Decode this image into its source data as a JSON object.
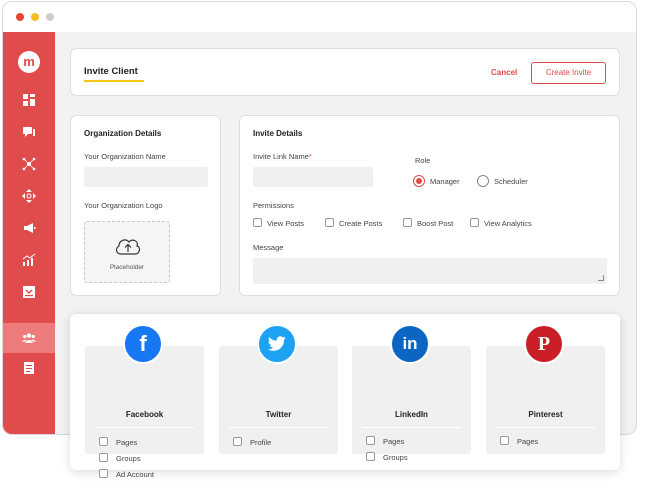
{
  "window": {
    "colors": {
      "accent": "#e04b4b",
      "underline": "#f5c518"
    }
  },
  "sidebar": {
    "logo": "m",
    "items": [
      {
        "icon": "dashboard-icon"
      },
      {
        "icon": "chat-icon"
      },
      {
        "icon": "network-icon"
      },
      {
        "icon": "move-icon"
      },
      {
        "icon": "megaphone-icon"
      },
      {
        "icon": "analytics-icon"
      },
      {
        "icon": "inbox-icon"
      },
      {
        "icon": "users-icon",
        "active": true
      },
      {
        "icon": "document-icon"
      }
    ]
  },
  "header": {
    "title": "Invite Client",
    "cancel_label": "Cancel",
    "create_label": "Create Invite"
  },
  "organization": {
    "title": "Organization Details",
    "name_label": "Your Organization Name",
    "name_value": "",
    "logo_label": "Your Organization Logo",
    "logo_placeholder": "Placeholder"
  },
  "invite": {
    "title": "Invite Details",
    "link_label": "Invite Link Name",
    "required_mark": "*",
    "link_value": "",
    "role_label": "Role",
    "roles": [
      {
        "label": "Manager",
        "selected": true
      },
      {
        "label": "Scheduler",
        "selected": false
      }
    ],
    "permissions_label": "Permissions",
    "permissions": [
      "View Posts",
      "Create Posts",
      "Boost Post",
      "View Analytics"
    ],
    "message_label": "Message",
    "message_value": ""
  },
  "social": [
    {
      "name": "Facebook",
      "icon": "facebook-icon",
      "glyph": "f",
      "color": "#1877f2",
      "options": [
        "Pages",
        "Groups",
        "Ad Account"
      ]
    },
    {
      "name": "Twitter",
      "icon": "twitter-icon",
      "glyph": "",
      "color": "#1da1f2",
      "options": [
        "Profile"
      ]
    },
    {
      "name": "LinkedIn",
      "icon": "linkedin-icon",
      "glyph": "in",
      "color": "#0a66c2",
      "options": [
        "Pages",
        "Groups"
      ]
    },
    {
      "name": "Pinterest",
      "icon": "pinterest-icon",
      "glyph": "P",
      "color": "#cb1f27",
      "options": [
        "Pages"
      ]
    }
  ]
}
